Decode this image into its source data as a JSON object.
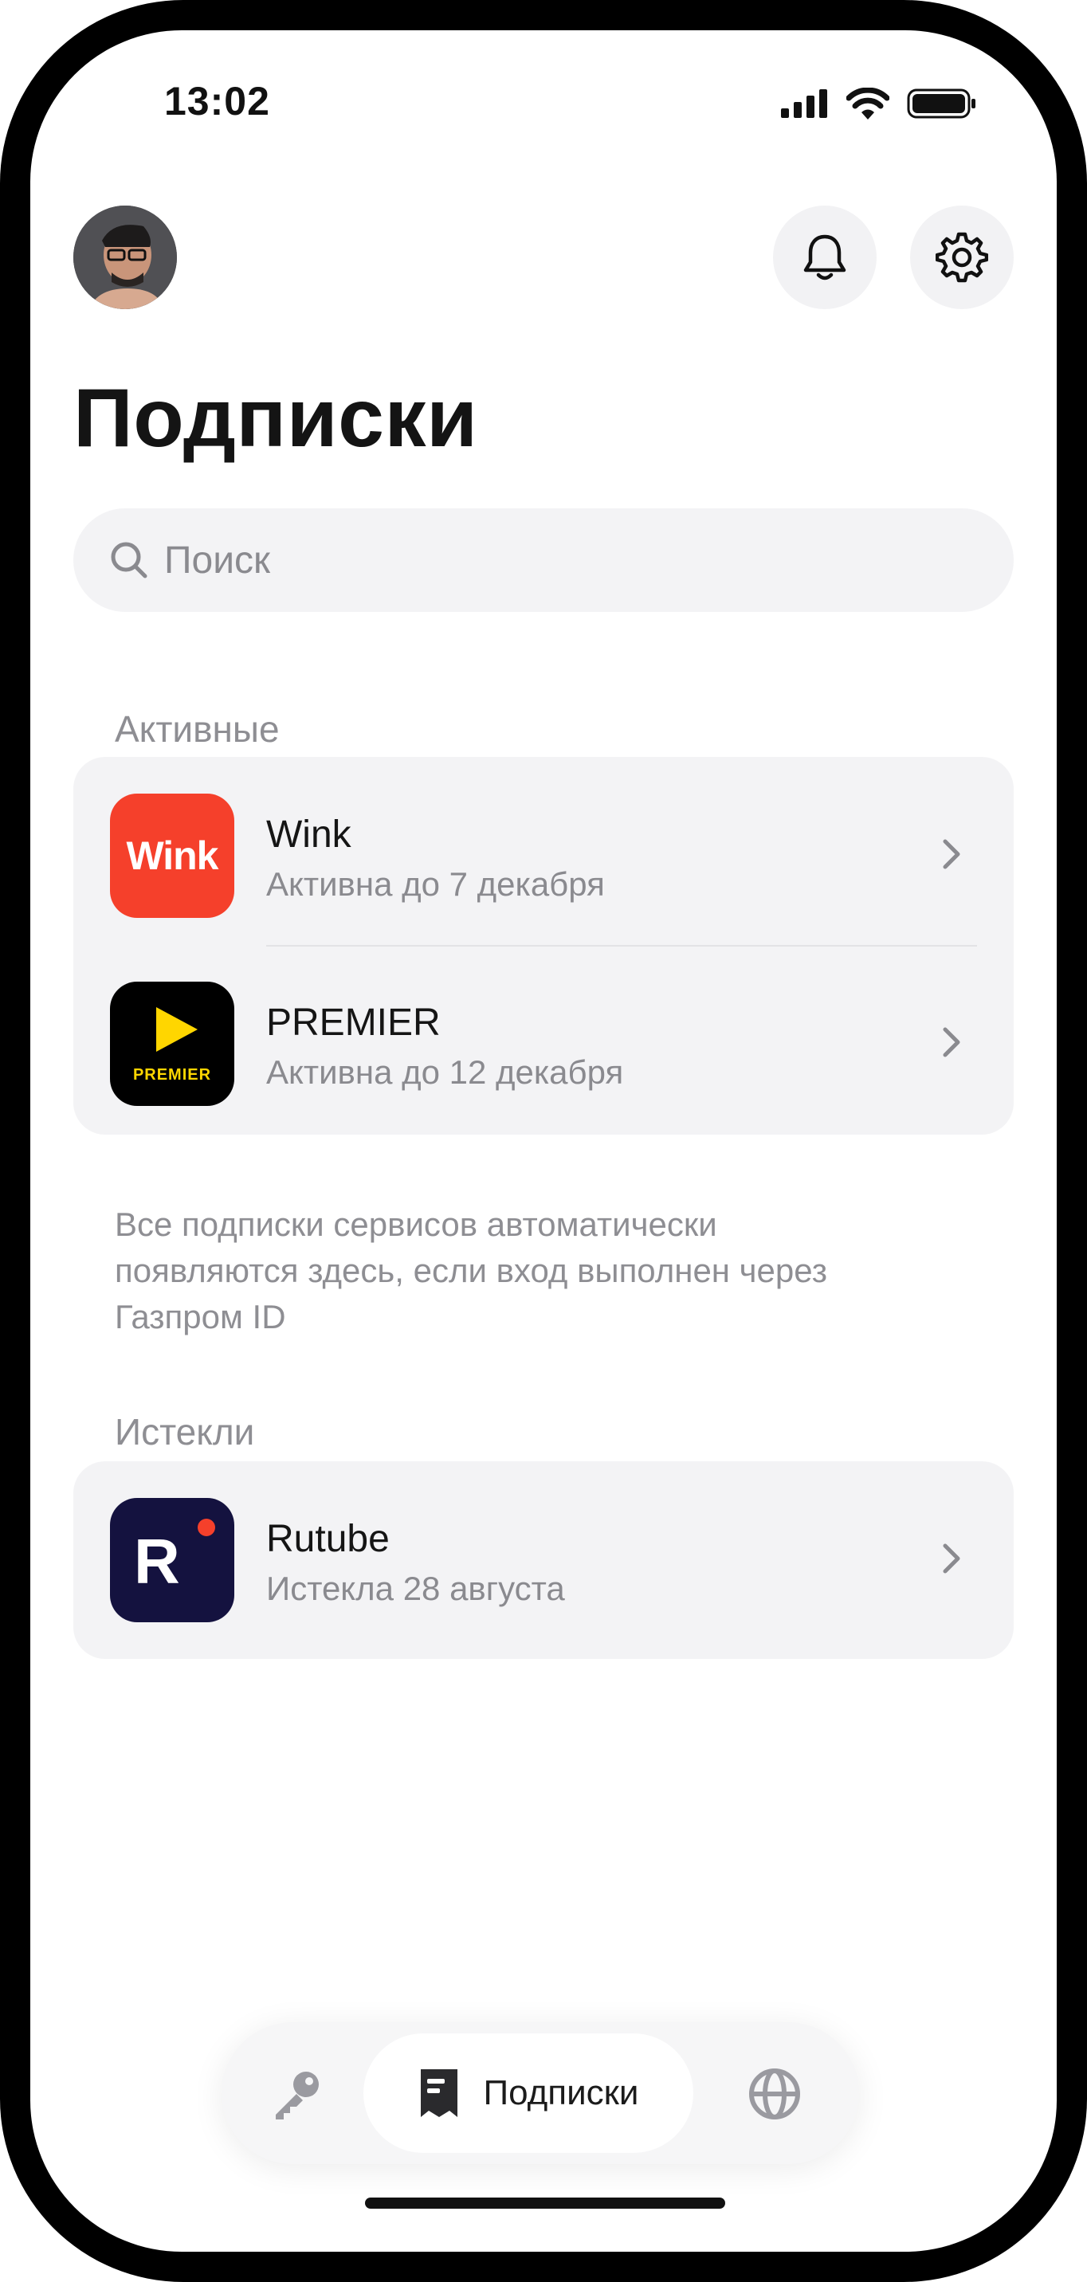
{
  "status_bar": {
    "time": "13:02"
  },
  "header": {
    "title": "Подписки"
  },
  "search": {
    "placeholder": "Поиск"
  },
  "active": {
    "label": "Активные",
    "items": [
      {
        "name": "Wink",
        "status": "Активна до 7 декабря",
        "logo_text": "Wink",
        "logo_color": "#f5402b"
      },
      {
        "name": "PREMIER",
        "status": "Активна до 12 декабря",
        "logo_text": "PREMIER",
        "logo_color": "#000000",
        "accent": "#ffd600"
      }
    ],
    "hint": "Все подписки сервисов автоматически появляются здесь, если вход выполнен через Газпром ID"
  },
  "expired": {
    "label": "Истекли",
    "items": [
      {
        "name": "Rutube",
        "status": "Истекла 28 августа",
        "logo_text": "R",
        "logo_color": "#14123f",
        "accent": "#f5402b"
      }
    ]
  },
  "tabbar": {
    "items": [
      {
        "icon": "key-icon",
        "label": ""
      },
      {
        "icon": "receipt-icon",
        "label": "Подписки",
        "active": true
      },
      {
        "icon": "globe-icon",
        "label": ""
      }
    ]
  }
}
